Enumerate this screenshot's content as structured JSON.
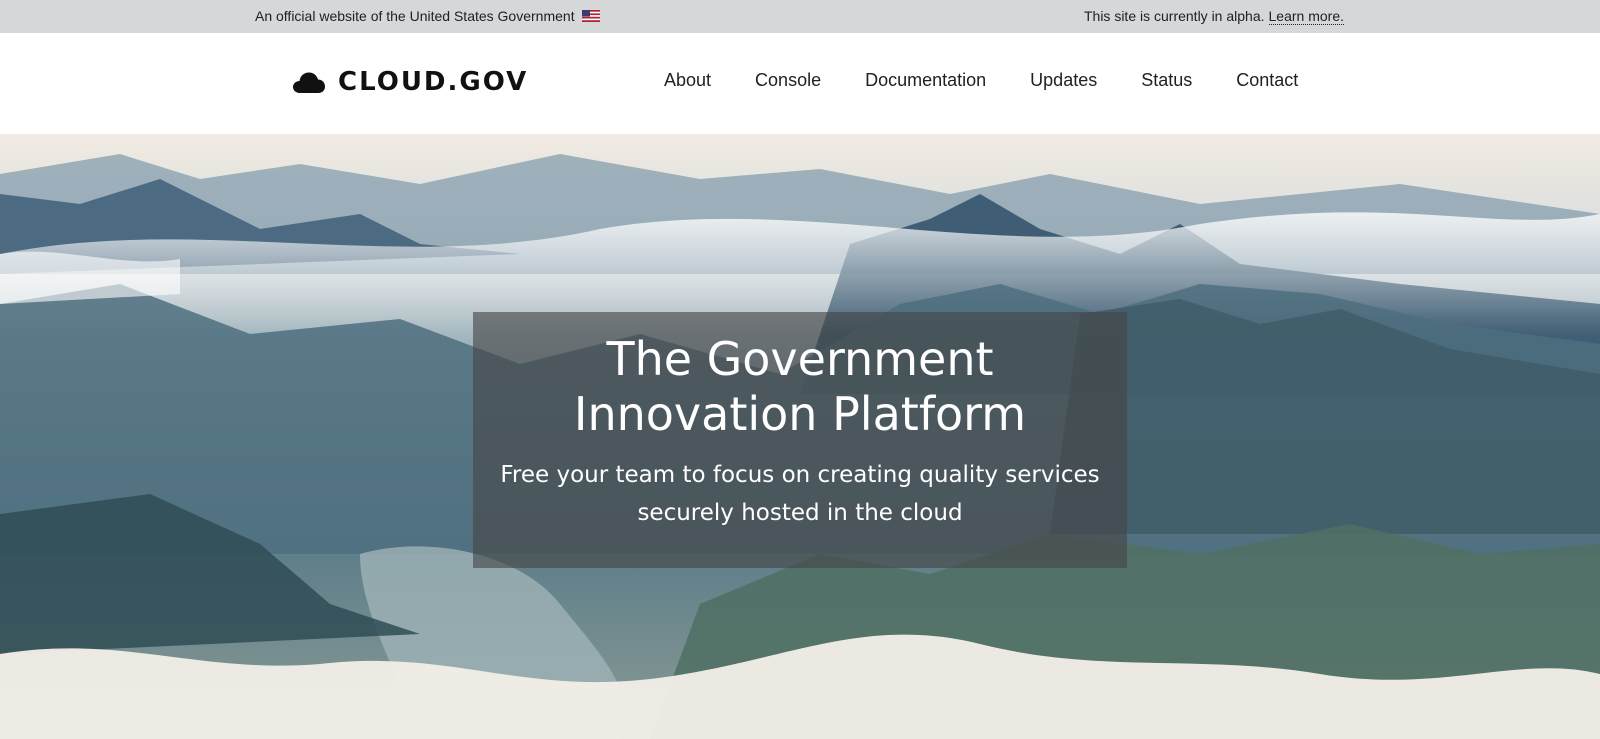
{
  "banner": {
    "official_text": "An official website of the United States Government",
    "alpha_text": "This site is currently in alpha.",
    "learn_more": "Learn more."
  },
  "header": {
    "logo_text": "CLOUD.GOV",
    "nav": [
      {
        "label": "About"
      },
      {
        "label": "Console"
      },
      {
        "label": "Documentation"
      },
      {
        "label": "Updates"
      },
      {
        "label": "Status"
      },
      {
        "label": "Contact"
      }
    ]
  },
  "hero": {
    "title_line1": "The Government",
    "title_line2": "Innovation Platform",
    "subtitle_line1": "Free your team to focus on creating quality services",
    "subtitle_line2": "securely hosted in the cloud"
  },
  "colors": {
    "banner_bg": "#d6d7d9",
    "header_bg": "#ffffff",
    "hero_overlay": "rgba(70,70,70,0.62)"
  },
  "icons": [
    "us-flag-icon",
    "cloud-icon"
  ]
}
